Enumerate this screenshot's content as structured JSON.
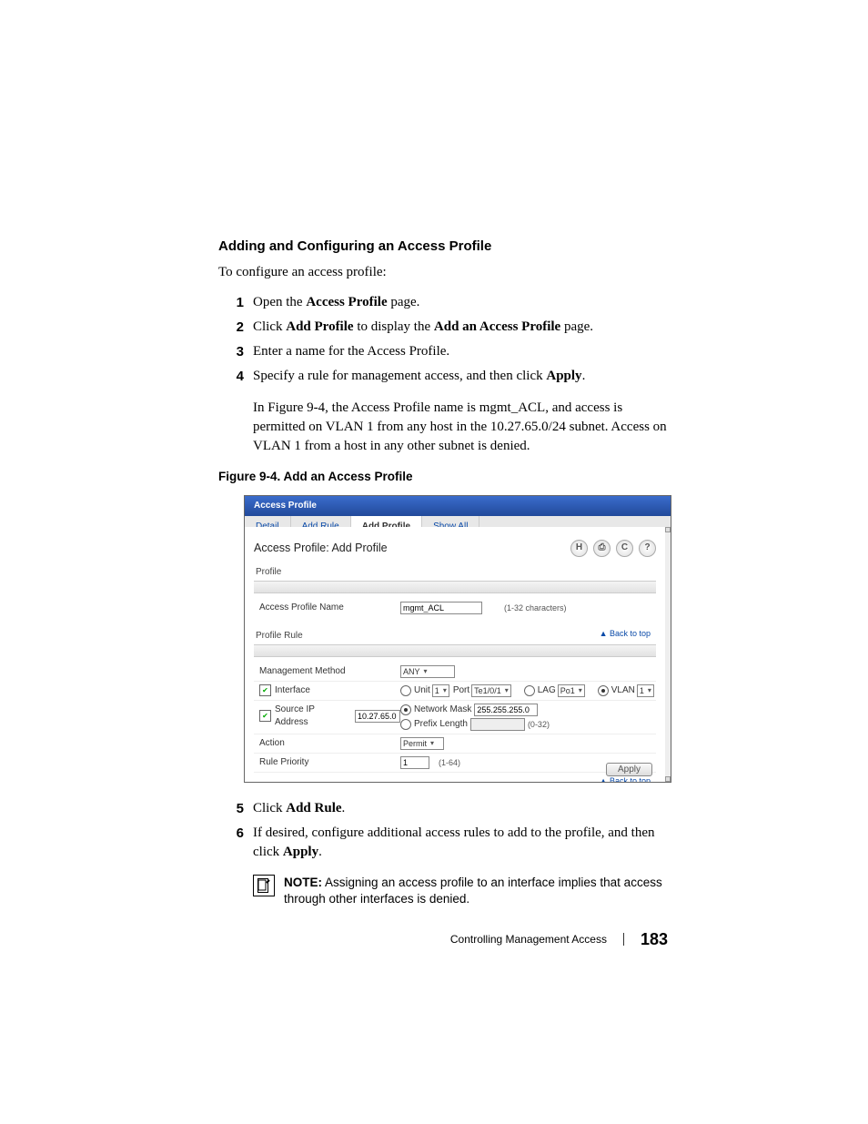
{
  "section_title": "Adding and Configuring an Access Profile",
  "intro": "To configure an access profile:",
  "steps_a": [
    {
      "n": "1",
      "pre": "Open the ",
      "bold": "Access Profile",
      "post": " page."
    },
    {
      "n": "2",
      "pre": "Click ",
      "bold": "Add Profile",
      "post_pre": " to display the ",
      "bold2": "Add an Access Profile",
      "post": " page."
    },
    {
      "n": "3",
      "pre": "Enter a name for the Access Profile.",
      "bold": "",
      "post": ""
    },
    {
      "n": "4",
      "pre": "Specify a rule for management access, and then click ",
      "bold": "Apply",
      "post": "."
    }
  ],
  "indent_para": "In Figure 9-4, the Access Profile name is mgmt_ACL, and access is permitted on VLAN 1 from any host in the 10.27.65.0/24 subnet. Access on VLAN 1 from a host in any other subnet is denied.",
  "figure_caption": "Figure 9-4.    Add an Access Profile",
  "screenshot": {
    "header": "Access Profile",
    "tabs": [
      "Detail",
      "Add Rule",
      "Add Profile",
      "Show All"
    ],
    "active_tab_index": 2,
    "title": "Access Profile: Add Profile",
    "icons": {
      "save": "H",
      "print": "⎙",
      "refresh": "C",
      "help": "?"
    },
    "section_profile": "Profile",
    "row_profile_name": {
      "label": "Access Profile Name",
      "value": "mgmt_ACL",
      "hint": "(1-32 characters)"
    },
    "section_rule": "Profile Rule",
    "back_to_top": "▲ Back to top",
    "row_method": {
      "label": "Management Method",
      "value": "ANY"
    },
    "row_interface": {
      "label": "Interface",
      "unit_label": "Unit",
      "unit_value": "1",
      "port_label": "Port",
      "port_value": "Te1/0/1",
      "lag_label": "LAG",
      "lag_value": "Po1",
      "vlan_label": "VLAN",
      "vlan_value": "1"
    },
    "row_source": {
      "label": "Source IP Address",
      "value": "10.27.65.0",
      "mask_label": "Network Mask",
      "mask_value": "255.255.255.0",
      "prefix_label": "Prefix Length",
      "prefix_hint": "(0-32)"
    },
    "row_action": {
      "label": "Action",
      "value": "Permit"
    },
    "row_priority": {
      "label": "Rule Priority",
      "value": "1",
      "hint": "(1-64)"
    },
    "apply_label": "Apply"
  },
  "steps_b": [
    {
      "n": "5",
      "pre": "Click ",
      "bold": "Add Rule",
      "post": "."
    },
    {
      "n": "6",
      "pre": "If desired, configure additional access rules to add to the profile, and then click ",
      "bold": "Apply",
      "post": "."
    }
  ],
  "note": {
    "label": "NOTE:",
    "text": " Assigning an access profile to an interface implies that access through other interfaces is denied."
  },
  "footer": {
    "chapter": "Controlling Management Access",
    "page": "183"
  }
}
